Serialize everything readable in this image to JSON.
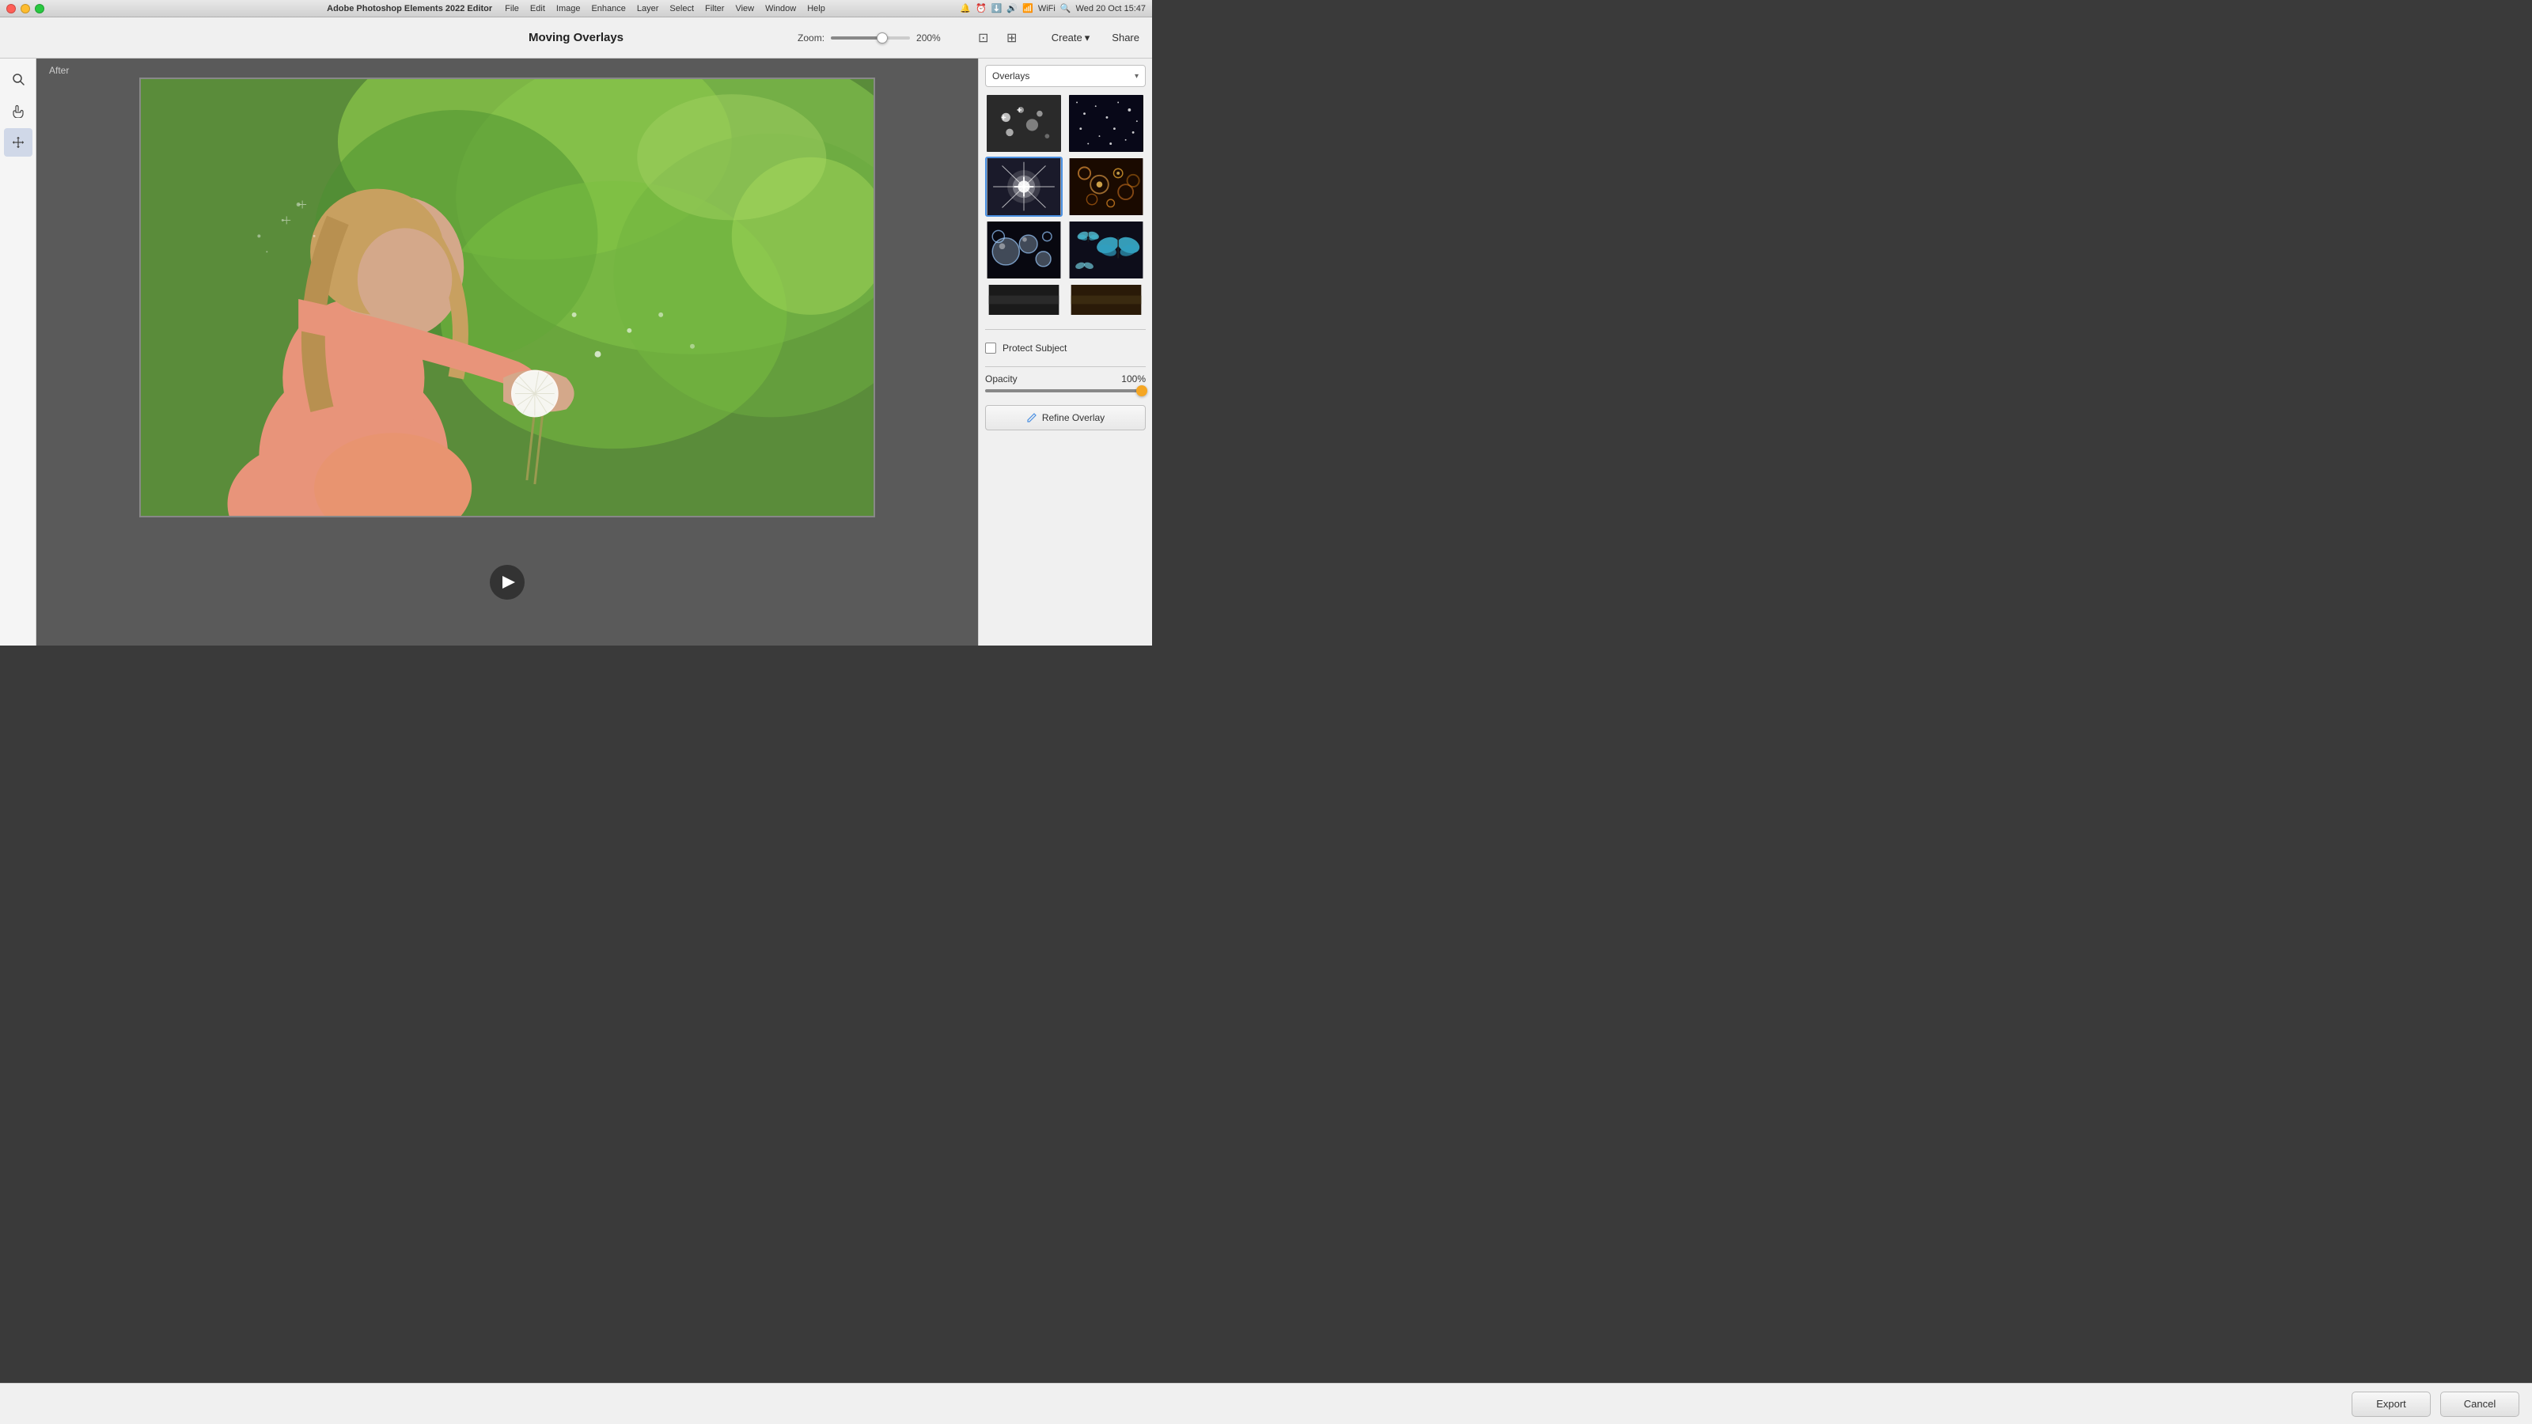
{
  "titlebar": {
    "app_name": "Adobe Photoshop Elements 2022 Editor",
    "menu_items": [
      "File",
      "Edit",
      "Image",
      "Enhance",
      "Layer",
      "Select",
      "Filter",
      "View",
      "Window",
      "Help"
    ],
    "datetime": "Wed 20 Oct  15:47"
  },
  "toolbar": {
    "title": "Moving Overlays",
    "zoom_label": "Zoom:",
    "zoom_value": "200%",
    "create_label": "Create",
    "share_label": "Share"
  },
  "canvas": {
    "after_label": "After"
  },
  "right_panel": {
    "overlays_label": "Overlays",
    "protect_subject_label": "Protect Subject",
    "opacity_label": "Opacity",
    "opacity_value": "100%",
    "refine_overlay_label": "Refine Overlay"
  },
  "bottom_bar": {
    "export_label": "Export",
    "cancel_label": "Cancel"
  }
}
